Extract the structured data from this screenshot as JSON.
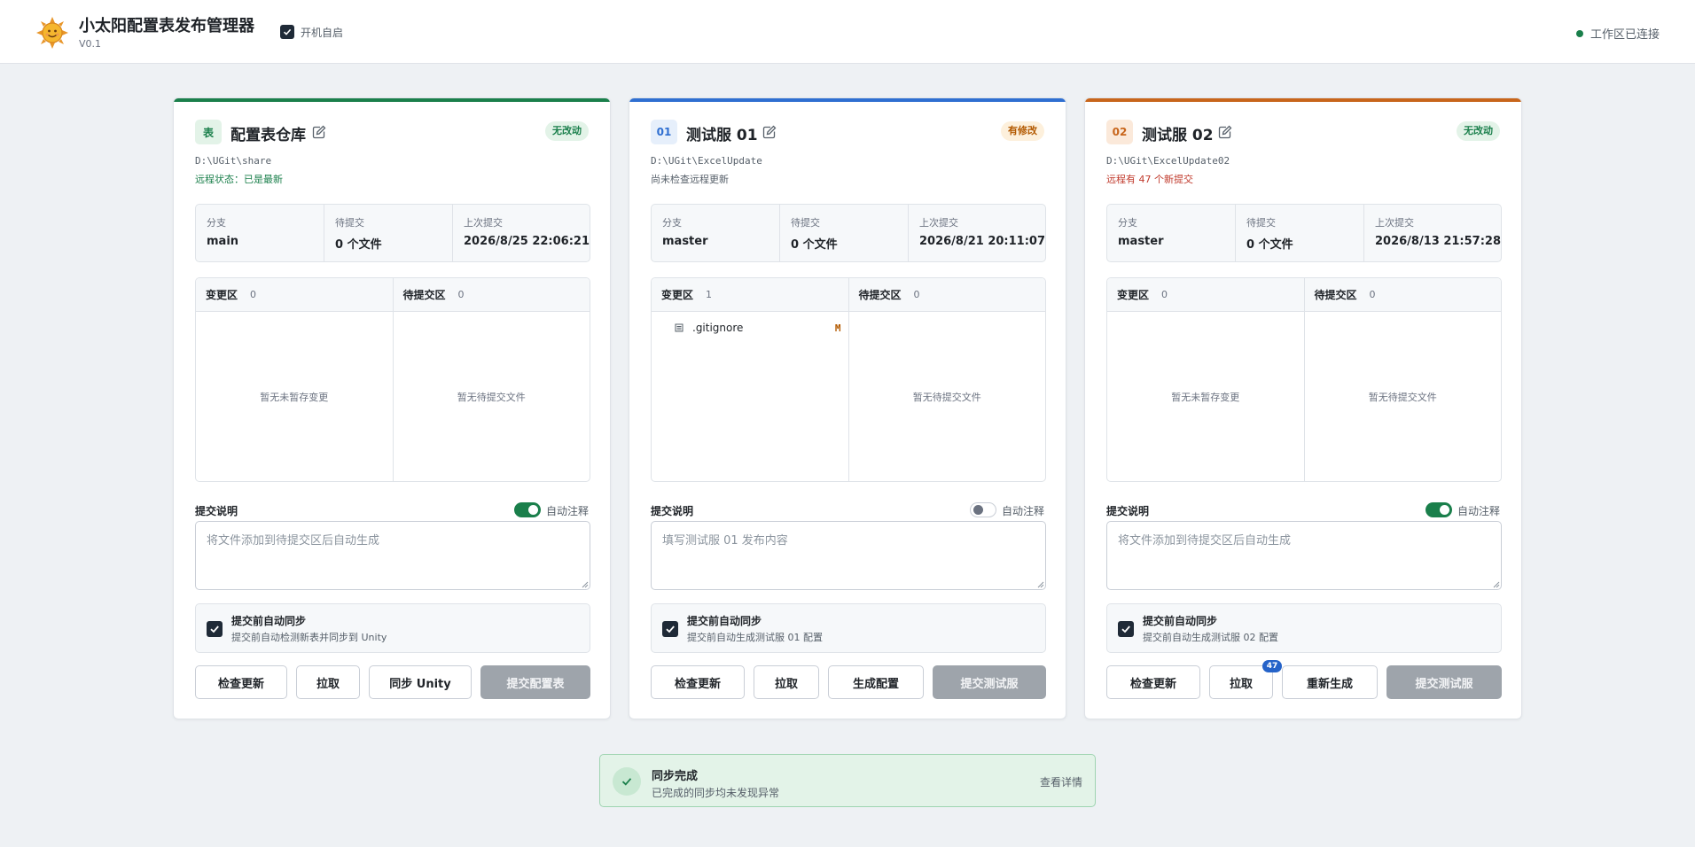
{
  "header": {
    "title": "小太阳配置表发布管理器",
    "version": "V0.1",
    "autostart_label": "开机自启",
    "autostart_checked": true,
    "connection_label": "工作区已连接",
    "connection_color": "#1a7f4b",
    "logo_icon": "sun-logo"
  },
  "cards": [
    {
      "accent": "#1a7f4b",
      "badge": "表",
      "title": "配置表仓库",
      "status": "无改动",
      "path": "D:\\UGit\\share",
      "remote": "远程状态：已是最新",
      "info": [
        {
          "key": "分支",
          "value": "main"
        },
        {
          "key": "待提交",
          "value": "0 个文件"
        },
        {
          "key": "上次提交",
          "value": "2026/8/25 22:06:21"
        }
      ],
      "changes": {
        "title": "变更区",
        "count": "0",
        "empty": "暂无未暂存变更"
      },
      "staged": {
        "title": "待提交区",
        "count": "0",
        "empty": "暂无待提交文件"
      },
      "message_label": "提交说明",
      "auto_comment": "自动注释",
      "auto_comment_on": true,
      "message_placeholder": "将文件添加到待提交区后自动生成",
      "sync_title": "提交前自动同步",
      "sync_desc": "提交前自动检测新表并同步到 Unity",
      "sync_checked": true,
      "buttons": [
        "检查更新",
        "拉取",
        "同步 Unity",
        "提交配置表"
      ]
    },
    {
      "accent": "#2f6fd1",
      "badge": "01",
      "title": "测试服 01",
      "status": "有修改",
      "path": "D:\\UGit\\ExcelUpdate",
      "remote": "尚未检查远程更新",
      "info": [
        {
          "key": "分支",
          "value": "master"
        },
        {
          "key": "待提交",
          "value": "0 个文件"
        },
        {
          "key": "上次提交",
          "value": "2026/8/21 20:11:07"
        }
      ],
      "changes": {
        "title": "变更区",
        "count": "1",
        "files": [
          {
            "name": ".gitignore",
            "status": "M"
          }
        ]
      },
      "staged": {
        "title": "待提交区",
        "count": "0",
        "empty": "暂无待提交文件"
      },
      "message_label": "提交说明",
      "auto_comment": "自动注释",
      "auto_comment_on": false,
      "message_placeholder": "填写测试服 01 发布内容",
      "sync_title": "提交前自动同步",
      "sync_desc": "提交前自动生成测试服 01 配置",
      "sync_checked": true,
      "buttons": [
        "检查更新",
        "拉取",
        "生成配置",
        "提交测试服"
      ]
    },
    {
      "accent": "#c8651b",
      "badge": "02",
      "title": "测试服 02",
      "status": "无改动",
      "path": "D:\\UGit\\ExcelUpdate02",
      "remote": "远程有 47 个新提交",
      "info": [
        {
          "key": "分支",
          "value": "master"
        },
        {
          "key": "待提交",
          "value": "0 个文件"
        },
        {
          "key": "上次提交",
          "value": "2026/8/13 21:57:28"
        }
      ],
      "changes": {
        "title": "变更区",
        "count": "0",
        "empty": "暂无未暂存变更"
      },
      "staged": {
        "title": "待提交区",
        "count": "0",
        "empty": "暂无待提交文件"
      },
      "message_label": "提交说明",
      "auto_comment": "自动注释",
      "auto_comment_on": true,
      "message_placeholder": "将文件添加到待提交区后自动生成",
      "sync_title": "提交前自动同步",
      "sync_desc": "提交前自动生成测试服 02 配置",
      "sync_checked": true,
      "buttons": [
        "检查更新",
        "拉取",
        "重新生成",
        "提交测试服"
      ],
      "pull_badge": "47"
    }
  ],
  "toast": {
    "title": "同步完成",
    "message": "已完成的同步均未发现异常",
    "action": "查看详情",
    "icon": "check-icon"
  }
}
